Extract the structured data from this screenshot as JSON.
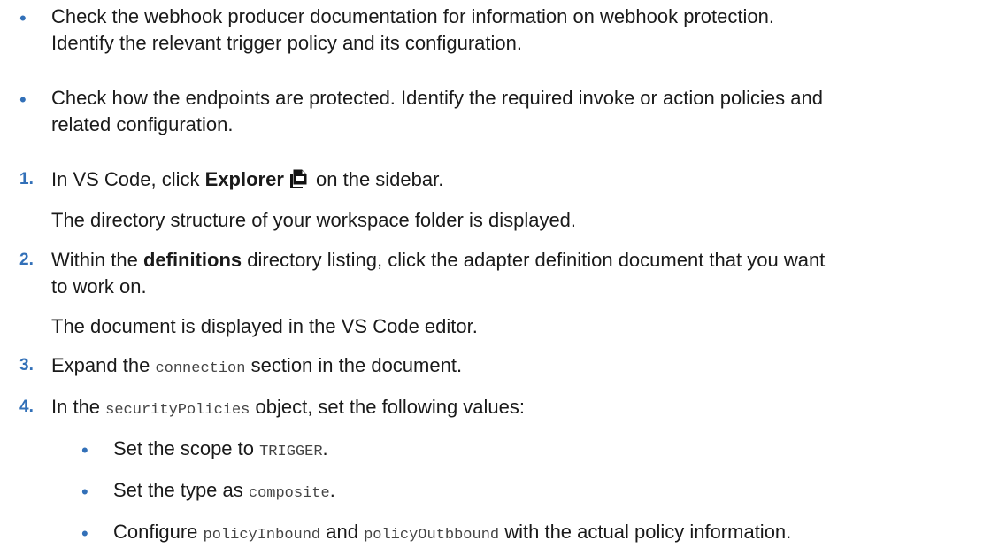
{
  "bullets": [
    {
      "line1": "Check the webhook producer documentation for information on webhook protection.",
      "line2": "Identify the relevant trigger policy and its configuration."
    },
    {
      "line1": "Check how the endpoints are protected. Identify the required invoke or action policies and",
      "line2": "related configuration."
    }
  ],
  "steps": [
    {
      "number": "1.",
      "pre": "In VS Code, click ",
      "bold": "Explorer",
      "icon": "explorer-files-icon",
      "post": " on the sidebar.",
      "result": "The directory structure of your workspace folder is displayed."
    },
    {
      "number": "2.",
      "pre": "Within the ",
      "bold": "definitions",
      "post1": " directory listing, click the adapter definition document that you want",
      "line2": "to work on.",
      "result": "The document is displayed in the VS Code editor."
    },
    {
      "number": "3.",
      "pre": "Expand the ",
      "code": "connection",
      "post": " section in the document."
    },
    {
      "number": "4.",
      "pre": "In the ",
      "code": "securityPolicies",
      "post": " object, set the following values:"
    }
  ],
  "sub_bullets": [
    {
      "pre": "Set the scope to ",
      "code": "TRIGGER",
      "post": "."
    },
    {
      "pre": "Set the type as ",
      "code": "composite",
      "post": "."
    },
    {
      "pre": "Configure ",
      "code1": "policyInbound",
      "mid": " and ",
      "code2": "policyOutbbound",
      "post": " with the actual policy information."
    }
  ],
  "bullet_char": "•"
}
